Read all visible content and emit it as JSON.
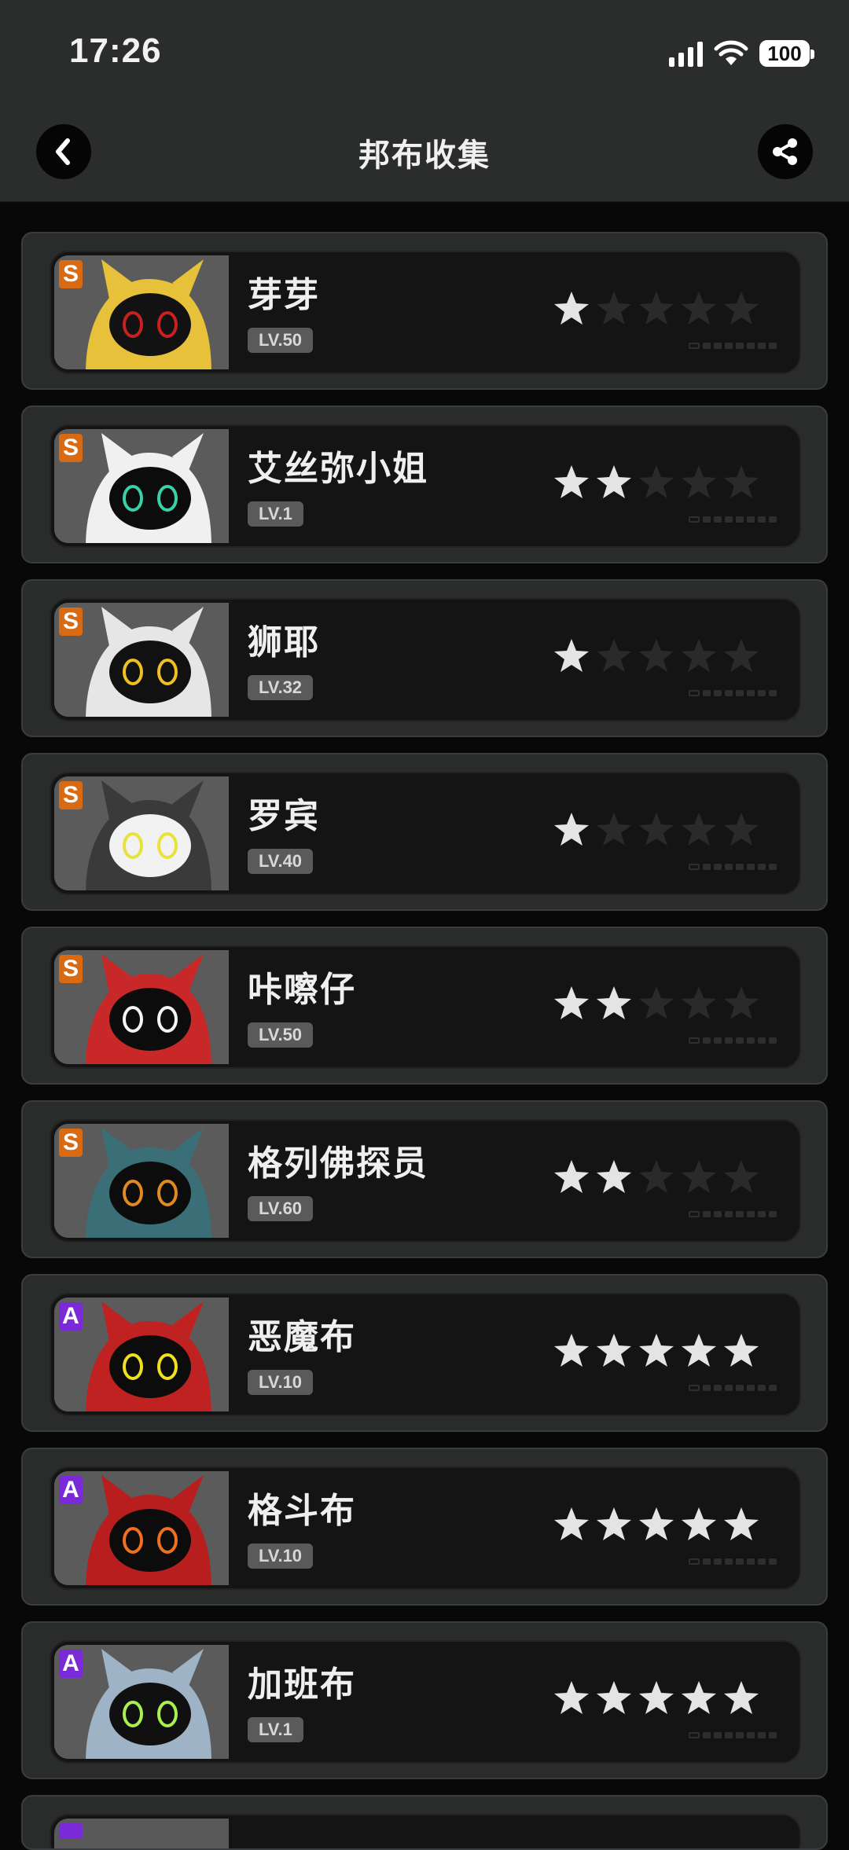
{
  "status_bar": {
    "time": "17:26",
    "battery": "100"
  },
  "header": {
    "title": "邦布收集"
  },
  "items": [
    {
      "rank": "S",
      "name": "芽芽",
      "level": "LV.50",
      "stars": 1
    },
    {
      "rank": "S",
      "name": "艾丝弥小姐",
      "level": "LV.1",
      "stars": 2
    },
    {
      "rank": "S",
      "name": "狮耶",
      "level": "LV.32",
      "stars": 1
    },
    {
      "rank": "S",
      "name": "罗宾",
      "level": "LV.40",
      "stars": 1
    },
    {
      "rank": "S",
      "name": "咔嚓仔",
      "level": "LV.50",
      "stars": 2
    },
    {
      "rank": "S",
      "name": "格列佛探员",
      "level": "LV.60",
      "stars": 2
    },
    {
      "rank": "A",
      "name": "恶魔布",
      "level": "LV.10",
      "stars": 5
    },
    {
      "rank": "A",
      "name": "格斗布",
      "level": "LV.10",
      "stars": 5
    },
    {
      "rank": "A",
      "name": "加班布",
      "level": "LV.1",
      "stars": 5
    }
  ],
  "colors": {
    "rank_S": "#d86a14",
    "rank_A": "#7a2ad6",
    "star_on": "#e4e4e4",
    "star_off": "#2a2a2a"
  }
}
